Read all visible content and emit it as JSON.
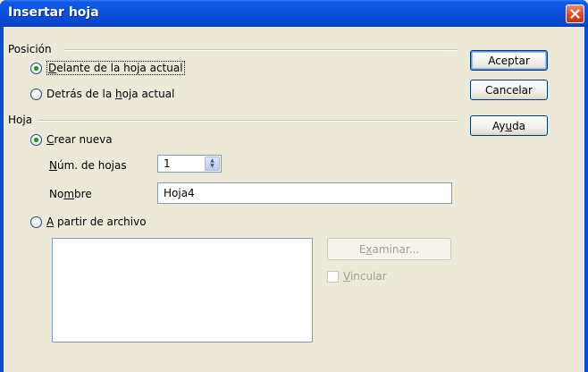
{
  "window": {
    "title": "Insertar hoja"
  },
  "position_group": {
    "label": "Posición",
    "options": [
      {
        "label_pre": "",
        "label_accel": "D",
        "label_post": "elante de la hoja actual",
        "checked": true
      },
      {
        "label_pre": "Detrás de la ",
        "label_accel": "h",
        "label_post": "oja actual",
        "checked": false
      }
    ]
  },
  "sheet_group": {
    "label": "Hoja",
    "create_new": {
      "label_pre": "",
      "label_accel": "C",
      "label_post": "rear nueva",
      "checked": true
    },
    "num_sheets": {
      "label_pre": "",
      "label_accel": "N",
      "label_post": "úm. de hojas",
      "value": "1"
    },
    "name": {
      "label_pre": "No",
      "label_accel": "m",
      "label_post": "bre",
      "value": "Hoja4"
    },
    "from_file": {
      "label_pre": "",
      "label_accel": "A",
      "label_post": " partir de archivo",
      "checked": false
    },
    "browse": {
      "label_pre": "E",
      "label_accel": "x",
      "label_post": "aminar..."
    },
    "link": {
      "label_pre": "",
      "label_accel": "V",
      "label_post": "incular"
    }
  },
  "buttons": {
    "ok": "Aceptar",
    "cancel": "Cancelar",
    "help_pre": "Ay",
    "help_accel": "u",
    "help_post": "da"
  },
  "colors": {
    "titlebar": "#0a53e0",
    "dialog_bg": "#ece9d8",
    "radio_dot": "#2a9a2a",
    "close_button": "#d84a24"
  },
  "icons": {
    "close": "close-icon",
    "spin": "spin-up-down-icon"
  }
}
